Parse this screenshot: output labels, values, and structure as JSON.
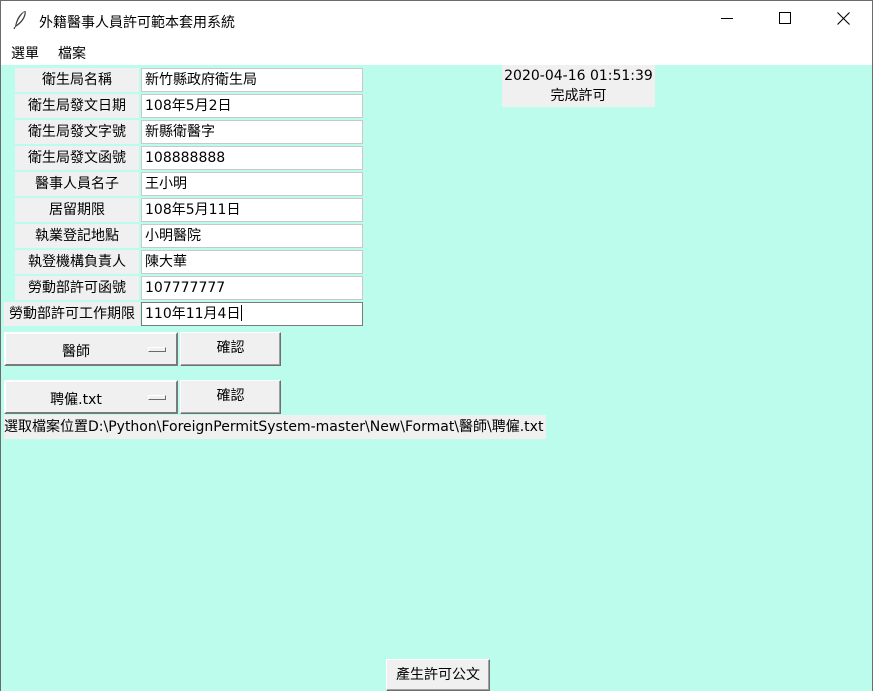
{
  "window": {
    "title": "外籍醫事人員許可範本套用系統"
  },
  "menubar": {
    "items": [
      "選單",
      "檔案"
    ]
  },
  "status": {
    "timestamp": "2020-04-16 01:51:39",
    "message": "完成許可"
  },
  "form": {
    "fields": [
      {
        "label": "衛生局名稱",
        "value": "新竹縣政府衛生局"
      },
      {
        "label": "衛生局發文日期",
        "value": "108年5月2日"
      },
      {
        "label": "衛生局發文字號",
        "value": "新縣衛醫字"
      },
      {
        "label": "衛生局發文函號",
        "value": "108888888"
      },
      {
        "label": "醫事人員名子",
        "value": "王小明"
      },
      {
        "label": "居留期限",
        "value": "108年5月11日"
      },
      {
        "label": "執業登記地點",
        "value": "小明醫院"
      },
      {
        "label": "執登機構負責人",
        "value": "陳大華"
      },
      {
        "label": "勞動部許可函號",
        "value": "107777777"
      },
      {
        "label": "勞動部許可工作期限",
        "value": "110年11月4日"
      }
    ]
  },
  "profession_select": {
    "selected": "醫師",
    "confirm_label": "確認"
  },
  "file_select": {
    "selected": "聘僱.txt",
    "confirm_label": "確認"
  },
  "path_label": "選取檔案位置D:\\Python\\ForeignPermitSystem-master\\New\\Format\\醫師\\聘僱.txt",
  "generate_button": "產生許可公文",
  "colors": {
    "client_background": "#bbfcec",
    "widget_background": "#f0f0f0"
  }
}
